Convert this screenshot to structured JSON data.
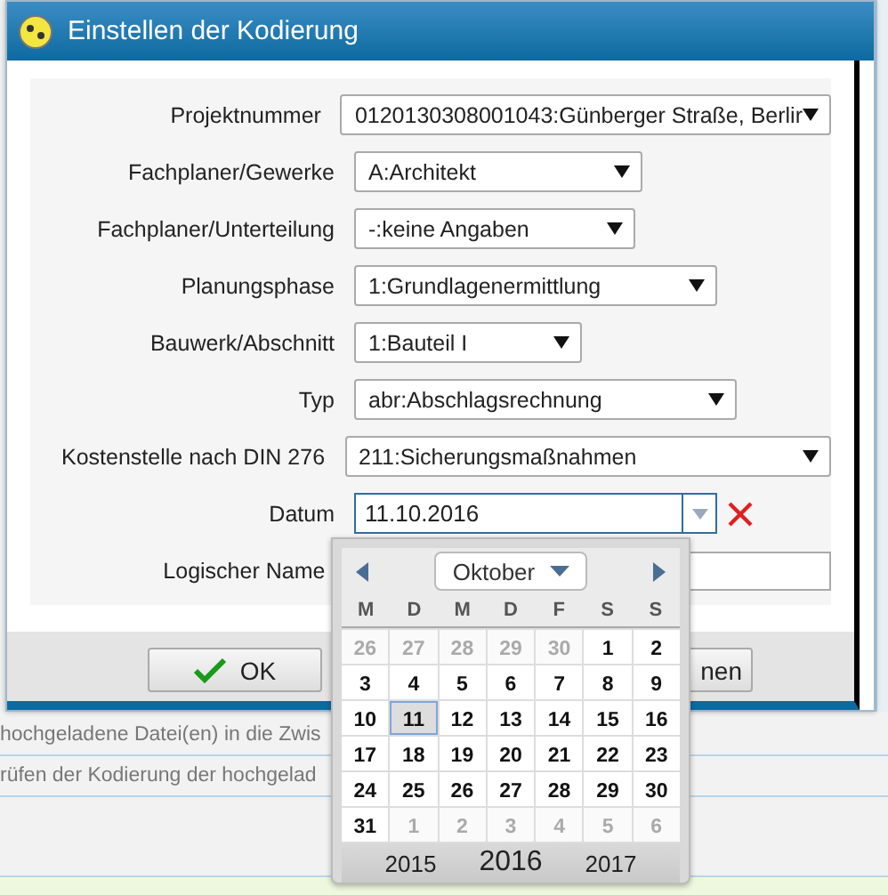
{
  "background": {
    "lines": [
      "hochgeladene Datei(en) in die Zwis",
      "rüfen der Kodierung der hochgelad"
    ]
  },
  "dialog": {
    "title": "Einstellen der Kodierung",
    "fields": [
      {
        "label": "Projektnummer",
        "kind": "select",
        "value": "0120130308001043:Günberger Straße, Berlir"
      },
      {
        "label": "Fachplaner/Gewerke",
        "kind": "select",
        "value": "A:Architekt"
      },
      {
        "label": "Fachplaner/Unterteilung",
        "kind": "select",
        "value": "-:keine Angaben"
      },
      {
        "label": "Planungsphase",
        "kind": "select",
        "value": "1:Grundlagenermittlung"
      },
      {
        "label": "Bauwerk/Abschnitt",
        "kind": "select",
        "value": "1:Bauteil I"
      },
      {
        "label": "Typ",
        "kind": "select",
        "value": "abr:Abschlagsrechnung"
      },
      {
        "label": "Kostenstelle nach DIN 276",
        "kind": "select",
        "value": "211:Sicherungsmaßnahmen"
      },
      {
        "label": "Datum",
        "kind": "date",
        "value": "11.10.2016"
      },
      {
        "label": "Logischer Name",
        "kind": "text"
      }
    ],
    "buttons": [
      {
        "label": "OK",
        "kind": "ok"
      },
      {
        "label": "nen",
        "kind": "plain"
      }
    ]
  },
  "calendar": {
    "month": "Oktober",
    "weekdays": [
      "M",
      "D",
      "M",
      "D",
      "F",
      "S",
      "S"
    ],
    "weeks": [
      [
        {
          "day": "26",
          "in_month": false,
          "selected": false
        },
        {
          "day": "27",
          "in_month": false,
          "selected": false
        },
        {
          "day": "28",
          "in_month": false,
          "selected": false
        },
        {
          "day": "29",
          "in_month": false,
          "selected": false
        },
        {
          "day": "30",
          "in_month": false,
          "selected": false
        },
        {
          "day": "1",
          "in_month": true,
          "selected": false
        },
        {
          "day": "2",
          "in_month": true,
          "selected": false
        }
      ],
      [
        {
          "day": "3",
          "in_month": true,
          "selected": false
        },
        {
          "day": "4",
          "in_month": true,
          "selected": false
        },
        {
          "day": "5",
          "in_month": true,
          "selected": false
        },
        {
          "day": "6",
          "in_month": true,
          "selected": false
        },
        {
          "day": "7",
          "in_month": true,
          "selected": false
        },
        {
          "day": "8",
          "in_month": true,
          "selected": false
        },
        {
          "day": "9",
          "in_month": true,
          "selected": false
        }
      ],
      [
        {
          "day": "10",
          "in_month": true,
          "selected": false
        },
        {
          "day": "11",
          "in_month": true,
          "selected": true
        },
        {
          "day": "12",
          "in_month": true,
          "selected": false
        },
        {
          "day": "13",
          "in_month": true,
          "selected": false
        },
        {
          "day": "14",
          "in_month": true,
          "selected": false
        },
        {
          "day": "15",
          "in_month": true,
          "selected": false
        },
        {
          "day": "16",
          "in_month": true,
          "selected": false
        }
      ],
      [
        {
          "day": "17",
          "in_month": true,
          "selected": false
        },
        {
          "day": "18",
          "in_month": true,
          "selected": false
        },
        {
          "day": "19",
          "in_month": true,
          "selected": false
        },
        {
          "day": "20",
          "in_month": true,
          "selected": false
        },
        {
          "day": "21",
          "in_month": true,
          "selected": false
        },
        {
          "day": "22",
          "in_month": true,
          "selected": false
        },
        {
          "day": "23",
          "in_month": true,
          "selected": false
        }
      ],
      [
        {
          "day": "24",
          "in_month": true,
          "selected": false
        },
        {
          "day": "25",
          "in_month": true,
          "selected": false
        },
        {
          "day": "26",
          "in_month": true,
          "selected": false
        },
        {
          "day": "27",
          "in_month": true,
          "selected": false
        },
        {
          "day": "28",
          "in_month": true,
          "selected": false
        },
        {
          "day": "29",
          "in_month": true,
          "selected": false
        },
        {
          "day": "30",
          "in_month": true,
          "selected": false
        }
      ],
      [
        {
          "day": "31",
          "in_month": true,
          "selected": false
        },
        {
          "day": "1",
          "in_month": false,
          "selected": false
        },
        {
          "day": "2",
          "in_month": false,
          "selected": false
        },
        {
          "day": "3",
          "in_month": false,
          "selected": false
        },
        {
          "day": "4",
          "in_month": false,
          "selected": false
        },
        {
          "day": "5",
          "in_month": false,
          "selected": false
        },
        {
          "day": "6",
          "in_month": false,
          "selected": false
        }
      ]
    ],
    "years": [
      {
        "label": "2015",
        "selected": false
      },
      {
        "label": "2016",
        "selected": true
      },
      {
        "label": "2017",
        "selected": false
      }
    ]
  }
}
